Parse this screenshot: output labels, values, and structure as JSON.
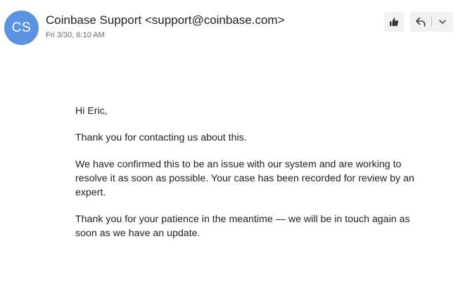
{
  "message": {
    "sender_initials": "CS",
    "sender": "Coinbase Support <support@coinbase.com>",
    "date": "Fri 3/30, 6:10 AM"
  },
  "icons": {
    "like": "thumbs-up-icon",
    "reply": "reply-icon",
    "more": "chevron-down-icon"
  },
  "colors": {
    "avatar_bg": "#5b93e0",
    "button_bg": "#f1f1f1"
  },
  "body": {
    "greeting": "Hi Eric,",
    "para1": "Thank you for contacting us about this.",
    "para2": "We have confirmed this to be an issue with our system and are working to resolve it as soon as possible. Your case has been recorded for review by an expert.",
    "para3": "Thank you for your patience in the meantime — we will be in touch again as soon as we have an update."
  }
}
